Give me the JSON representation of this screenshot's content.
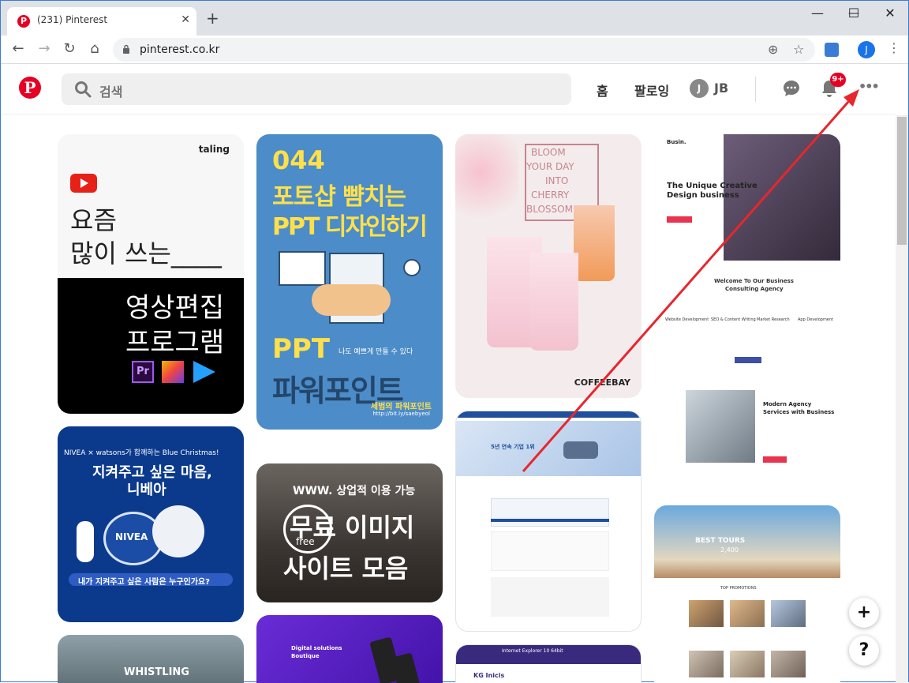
{
  "browser": {
    "tab_title": "(231) Pinterest",
    "tab_close": "✕",
    "new_tab": "+",
    "url": "pinterest.co.kr",
    "profile_initial": "J",
    "window_minimize": "—",
    "window_maximize": "☐",
    "window_close": "✕"
  },
  "header": {
    "logo": "P",
    "search_placeholder": "검색",
    "nav_home": "홈",
    "nav_following": "팔로잉",
    "user_initial": "J",
    "user_name": "JB",
    "notification_badge": "9+",
    "more_icon": "•••"
  },
  "pins": {
    "p1": {
      "brand": "taling",
      "line1": "요즘",
      "line2": "많이 쓰는____",
      "line3": "영상편집",
      "line4": "프로그램"
    },
    "p2": {
      "number": "044",
      "title1": "포토샵 뺨치는",
      "title2": "PPT 디자인하기",
      "sub1": "PPT",
      "sub_small": "나도 예쁘게 만들 수 있다",
      "sub2": "파워포인트",
      "footer": "세범의 파워포인트",
      "footer_small": "http://bit.ly/saebyeol"
    },
    "p3": {
      "line1": "BLOOM",
      "line2": "YOUR DAY",
      "line3": "INTO",
      "line4": "CHERRY",
      "line5": "BLOSSOM",
      "brand": "COFFEEBAY"
    },
    "p4": {
      "brand": "Busin.",
      "headline1": "The Unique Creative",
      "headline2": "Design business",
      "welcome1": "Welcome To Our Business",
      "welcome2": "Consulting Agency",
      "s1": "Website Development",
      "s2": "SEO & Content Writing",
      "s3": "Market Research",
      "s4": "App Development",
      "agency1": "Modern Agency",
      "agency2": "Services with Business"
    },
    "p5": {
      "top": "NIVEA × watsons가 함께하는 Blue Christmas!",
      "line1": "지켜주고 싶은 마음,",
      "line2": "니베아",
      "ribbon": "내가 지켜주고 싶은 사람은 누구인가요?",
      "nivea": "NIVEA"
    },
    "p6": {
      "top": "WWW. 상업적 이용 가능",
      "line1": "무료 이미지",
      "line2": "사이트 모음",
      "free": "free"
    },
    "p7": {
      "title": "5년 연속 기업 1위"
    },
    "p8": {
      "banner": "BEST TOURS",
      "price": "2,400",
      "section": "TOP PROMOTIONS"
    },
    "p9": {
      "label": "WHISTLING"
    },
    "p10": {
      "title1": "Digital solutions",
      "title2": "Boutique"
    },
    "p11": {
      "title": "Internet Explorer 10 64bit",
      "brand": "KG Inicis"
    }
  },
  "fab": {
    "add": "+",
    "help": "?"
  },
  "arrow_color": "#e8262d"
}
